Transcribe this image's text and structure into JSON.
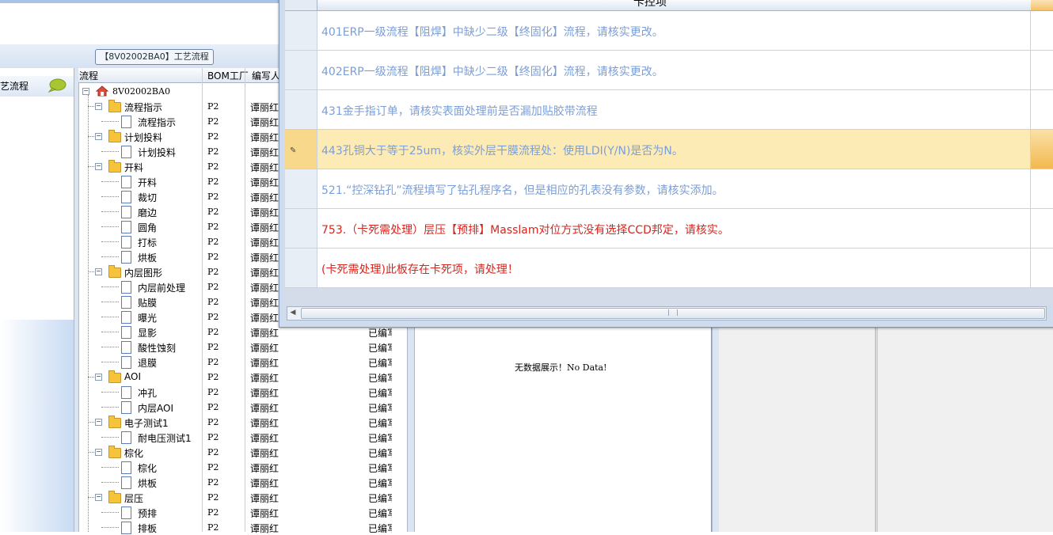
{
  "process_tab": "【8V02002BA0】工艺流程",
  "left_item_label": "艺流程",
  "tree_headers": {
    "flow": "流程",
    "bom": "BOM工厂",
    "writer": "编写人"
  },
  "tree_root": "8V02002BA0",
  "tree_rows": [
    {
      "label": "流程指示",
      "type": "folder",
      "level": 1,
      "bom": "P2",
      "writer": "谭丽红"
    },
    {
      "label": "流程指示",
      "type": "doc",
      "level": 2,
      "bom": "P2",
      "writer": "谭丽红"
    },
    {
      "label": "计划投料",
      "type": "folder",
      "level": 1,
      "bom": "P2",
      "writer": "谭丽红"
    },
    {
      "label": "计划投料",
      "type": "doc",
      "level": 2,
      "bom": "P2",
      "writer": "谭丽红"
    },
    {
      "label": "开料",
      "type": "folder",
      "level": 1,
      "bom": "P2",
      "writer": "谭丽红"
    },
    {
      "label": "开料",
      "type": "doc",
      "level": 2,
      "bom": "P2",
      "writer": "谭丽红"
    },
    {
      "label": "裁切",
      "type": "doc",
      "level": 2,
      "bom": "P2",
      "writer": "谭丽红"
    },
    {
      "label": "磨边",
      "type": "doc",
      "level": 2,
      "bom": "P2",
      "writer": "谭丽红"
    },
    {
      "label": "圆角",
      "type": "doc",
      "level": 2,
      "bom": "P2",
      "writer": "谭丽红"
    },
    {
      "label": "打标",
      "type": "doc",
      "level": 2,
      "bom": "P2",
      "writer": "谭丽红"
    },
    {
      "label": "烘板",
      "type": "doc",
      "level": 2,
      "bom": "P2",
      "writer": "谭丽红"
    },
    {
      "label": "内层图形",
      "type": "folder",
      "level": 1,
      "bom": "P2",
      "writer": "谭丽红"
    },
    {
      "label": "内层前处理",
      "type": "doc",
      "level": 2,
      "bom": "P2",
      "writer": "谭丽红"
    },
    {
      "label": "贴膜",
      "type": "doc",
      "level": 2,
      "bom": "P2",
      "writer": "谭丽红"
    },
    {
      "label": "曝光",
      "type": "doc",
      "level": 2,
      "bom": "P2",
      "writer": "谭丽红"
    },
    {
      "label": "显影",
      "type": "doc",
      "level": 2,
      "bom": "P2",
      "writer": "谭丽红"
    },
    {
      "label": "酸性蚀刻",
      "type": "doc",
      "level": 2,
      "bom": "P2",
      "writer": "谭丽红"
    },
    {
      "label": "退膜",
      "type": "doc",
      "level": 2,
      "bom": "P2",
      "writer": "谭丽红"
    },
    {
      "label": "AOI",
      "type": "folder",
      "level": 1,
      "bom": "P2",
      "writer": "谭丽红"
    },
    {
      "label": "冲孔",
      "type": "doc",
      "level": 2,
      "bom": "P2",
      "writer": "谭丽红"
    },
    {
      "label": "内层AOI",
      "type": "doc",
      "level": 2,
      "bom": "P2",
      "writer": "谭丽红"
    },
    {
      "label": "电子测试1",
      "type": "folder",
      "level": 1,
      "bom": "P2",
      "writer": "谭丽红"
    },
    {
      "label": "耐电压测试1",
      "type": "doc",
      "level": 2,
      "bom": "P2",
      "writer": "谭丽红"
    },
    {
      "label": "棕化",
      "type": "folder",
      "level": 1,
      "bom": "P2",
      "writer": "谭丽红"
    },
    {
      "label": "棕化",
      "type": "doc",
      "level": 2,
      "bom": "P2",
      "writer": "谭丽红"
    },
    {
      "label": "烘板",
      "type": "doc",
      "level": 2,
      "bom": "P2",
      "writer": "谭丽红"
    },
    {
      "label": "层压",
      "type": "folder",
      "level": 1,
      "bom": "P2",
      "writer": "谭丽红"
    },
    {
      "label": "预排",
      "type": "doc",
      "level": 2,
      "bom": "P2",
      "writer": "谭丽红"
    },
    {
      "label": "排板",
      "type": "doc",
      "level": 2,
      "bom": "P2",
      "writer": "谭丽红"
    }
  ],
  "status_text": "已编写",
  "no_data": "无数据展示！No Data!",
  "dialog": {
    "column_title": "卡控项",
    "messages": [
      {
        "text": "401ERP一级流程【阻焊】中缺少二级【终固化】流程，请核实更改。",
        "color": "blue"
      },
      {
        "text": "402ERP一级流程【阻焊】中缺少二级【终固化】流程，请核实更改。",
        "color": "blue"
      },
      {
        "text": "431金手指订单，请核实表面处理前是否漏加贴胶带流程",
        "color": "blue"
      },
      {
        "text": "443孔铜大于等于25um，核实外层干膜流程处：使用LDI(Y/N)是否为N。",
        "color": "blue",
        "selected": true
      },
      {
        "text": "521.“控深钻孔”流程填写了钻孔程序名，但是相应的孔表没有参数，请核实添加。",
        "color": "blue"
      },
      {
        "text": "753.（卡死需处理）层压【预排】Masslam对位方式没有选择CCD邦定，请核实。",
        "color": "red"
      },
      {
        "text": "(卡死需处理)此板存在卡死项，请处理！",
        "color": "red"
      }
    ]
  },
  "colors": {
    "accent": "#7a9ed8",
    "error": "#d9251d",
    "selection": "#fdebb6"
  }
}
